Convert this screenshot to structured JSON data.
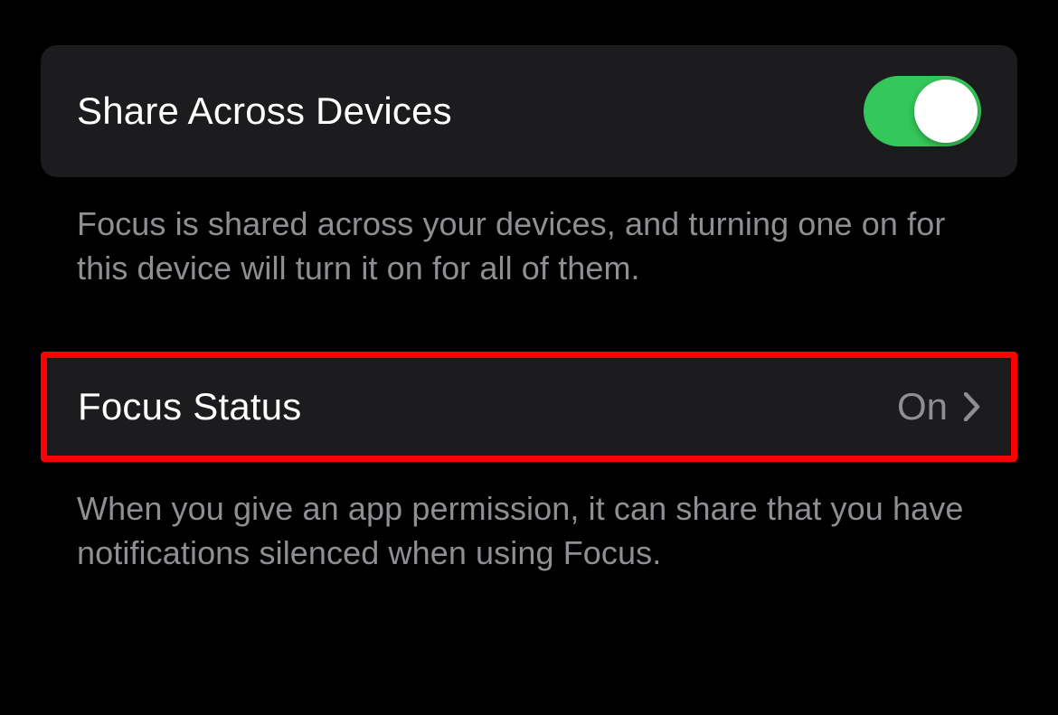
{
  "share_section": {
    "label": "Share Across Devices",
    "toggle_on": true,
    "footer": "Focus is shared across your devices, and turning one on for this device will turn it on for all of them."
  },
  "focus_status_section": {
    "label": "Focus Status",
    "value": "On",
    "footer": "When you give an app permission, it can share that you have notifications silenced when using Focus."
  }
}
